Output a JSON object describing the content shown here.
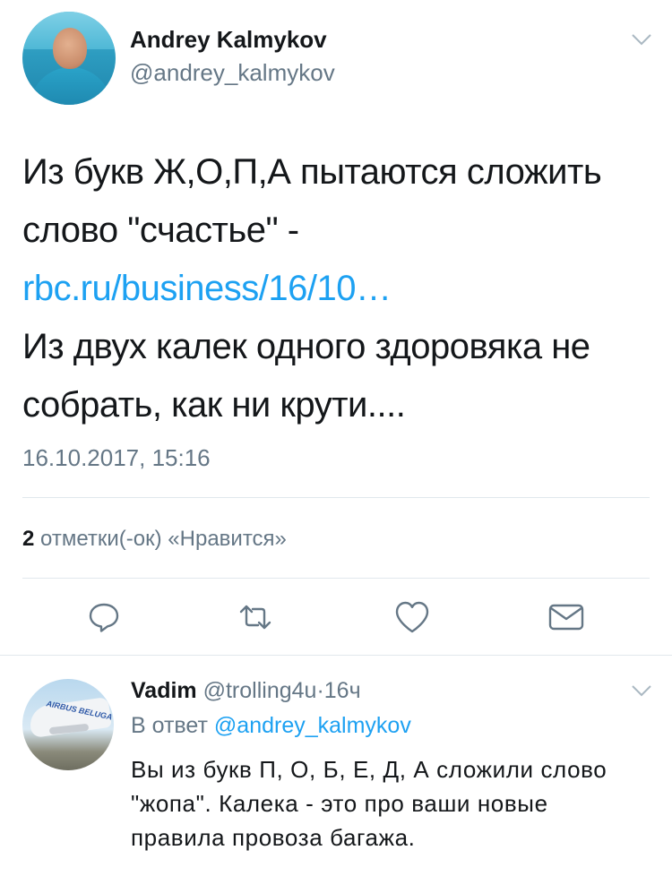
{
  "tweet": {
    "author_name": "Andrey Kalmykov",
    "author_handle": "@andrey_kalmykov",
    "text_part1": "Из букв Ж,О,П,А пытаются сложить слово \"счастье\" -",
    "link_text": "rbc.ru/business/16/10…",
    "text_part2": "Из двух калек одного здоровяка не собрать, как ни крути....",
    "timestamp": "16.10.2017, 15:16",
    "likes_count": "2",
    "likes_label": "отметки(-ок) «Нравится»"
  },
  "actions": {
    "reply_icon": "reply-icon",
    "retweet_icon": "retweet-icon",
    "like_icon": "like-icon",
    "dm_icon": "envelope-icon"
  },
  "reply": {
    "author_name": "Vadim",
    "author_handle": "@trolling4u",
    "separator": "·",
    "time": "16ч",
    "in_reply_prefix": "В ответ",
    "in_reply_handle": "@andrey_kalmykov",
    "text": "Вы из букв П, О, Б, Е, Д, А сложили слово \"жопа\". Калека - это про ваши новые правила провоза багажа.",
    "avatar_text": "AIRBUS BELUGA"
  },
  "colors": {
    "link": "#1da1f2",
    "secondary_text": "#657786",
    "primary_text": "#14171a",
    "divider": "#e1e8ed"
  }
}
